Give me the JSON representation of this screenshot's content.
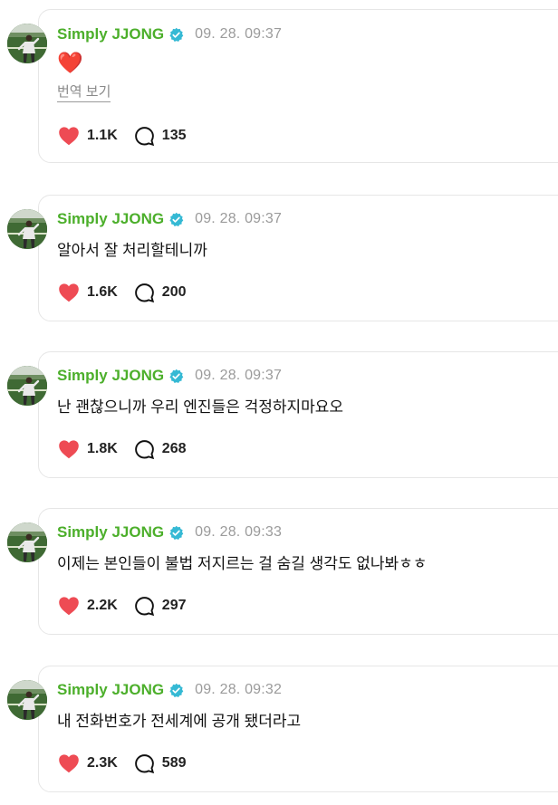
{
  "colors": {
    "username": "#4caf2b",
    "verified": "#35b9d4",
    "heart": "#ee4b54",
    "timestamp": "#9b9b9b"
  },
  "posts": [
    {
      "username": "Simply JJONG",
      "time": "09. 28. 09:37",
      "text": "❤️",
      "translate_label": "번역 보기",
      "likes": "1.1K",
      "comments": "135"
    },
    {
      "username": "Simply JJONG",
      "time": "09. 28. 09:37",
      "text": "알아서 잘 처리할테니까",
      "likes": "1.6K",
      "comments": "200"
    },
    {
      "username": "Simply JJONG",
      "time": "09. 28. 09:37",
      "text": "난 괜찮으니까 우리 엔진들은 걱정하지마요오",
      "likes": "1.8K",
      "comments": "268"
    },
    {
      "username": "Simply JJONG",
      "time": "09. 28. 09:33",
      "text": "이제는 본인들이 불법 저지르는 걸 숨길 생각도 없나봐ㅎㅎ",
      "likes": "2.2K",
      "comments": "297"
    },
    {
      "username": "Simply JJONG",
      "time": "09. 28. 09:32",
      "text": "내 전화번호가 전세계에 공개 됐더라고",
      "likes": "2.3K",
      "comments": "589"
    }
  ]
}
